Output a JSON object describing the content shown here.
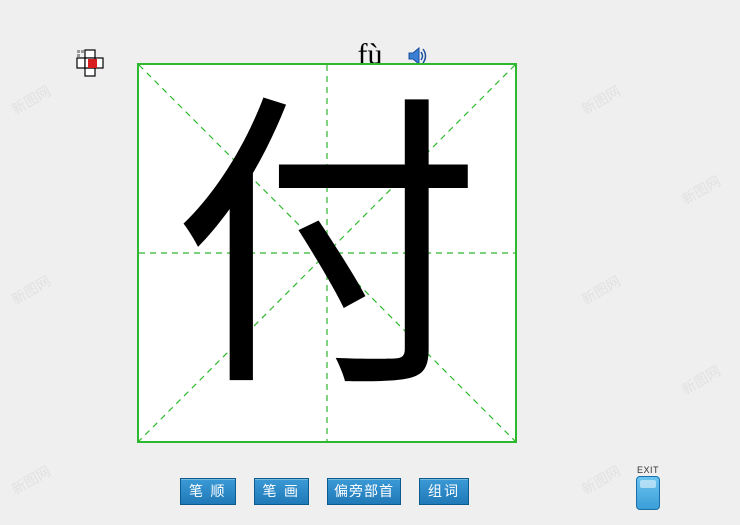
{
  "pinyin": "fù",
  "character": "付",
  "buttons": {
    "stroke_order": "笔 顺",
    "stroke_count": "笔 画",
    "radical": "偏旁部首",
    "words": "组词"
  },
  "exit_label": "EXIT",
  "watermark_text": "新图网",
  "icons": {
    "flower": "flower-icon",
    "speaker": "speaker-icon",
    "exit": "exit-icon"
  }
}
